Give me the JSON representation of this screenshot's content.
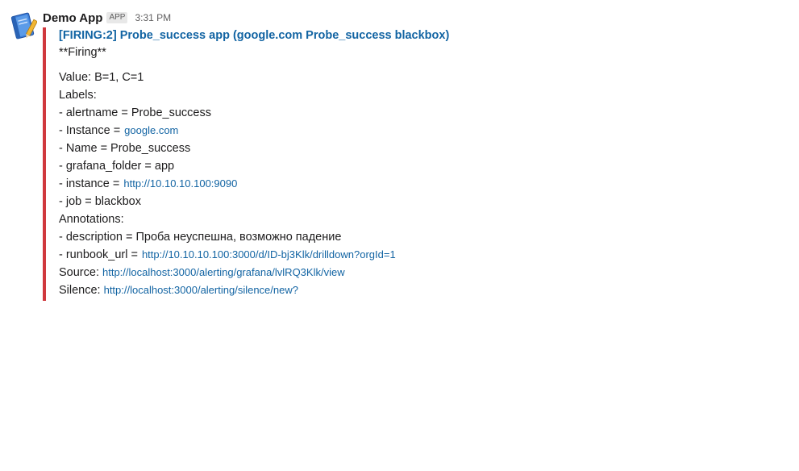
{
  "message": {
    "sender": "Demo App",
    "badge": "APP",
    "time": "3:31 PM",
    "accent_color": "#d0383d",
    "link_color": "#1264a3",
    "avatar_icon": "blue-notebook-icon"
  },
  "attachment": {
    "title": "[FIRING:2] Probe_success app (google.com Probe_success blackbox)",
    "firing": "**Firing**",
    "value_line": "Value: B=1, C=1",
    "labels_heading": "Labels:",
    "labels": {
      "alertname": "- alertname = Probe_success",
      "instance_prefix": "- Instance =",
      "instance_link": "google.com",
      "name": "- Name = Probe_success",
      "grafana_folder": "- grafana_folder = app",
      "instance2_prefix": "- instance =",
      "instance2_link": "http://10.10.10.100:9090",
      "job": "- job = blackbox"
    },
    "annotations_heading": "Annotations:",
    "annotations": {
      "description": "- description = Проба неуспешна, возможно падение",
      "runbook_prefix": "- runbook_url =",
      "runbook_link": "http://10.10.10.100:3000/d/ID-bj3Klk/drilldown?orgId=1"
    },
    "source_prefix": "Source:",
    "source_link": "http://localhost:3000/alerting/grafana/lvlRQ3Klk/view",
    "silence_prefix": "Silence:",
    "silence_link": "http://localhost:3000/alerting/silence/new?"
  }
}
